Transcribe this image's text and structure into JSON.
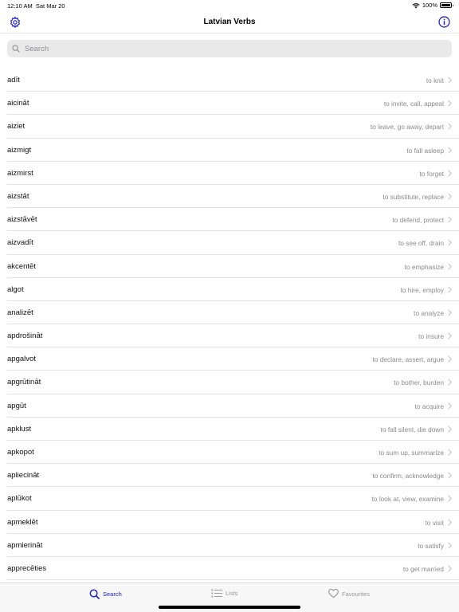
{
  "status_bar": {
    "time": "12:10 AM",
    "date": "Sat Mar 20",
    "battery": "100%",
    "battery_level": 1.0
  },
  "nav": {
    "title": "Latvian Verbs"
  },
  "search": {
    "placeholder": "Search"
  },
  "verbs": [
    {
      "verb": "adīt",
      "translation": "to knit"
    },
    {
      "verb": "aicināt",
      "translation": "to invite, call, appeal"
    },
    {
      "verb": "aiziet",
      "translation": "to leave, go away, depart"
    },
    {
      "verb": "aizmigt",
      "translation": "to fall asleep"
    },
    {
      "verb": "aizmirst",
      "translation": "to forget"
    },
    {
      "verb": "aizstāt",
      "translation": "to substitute, replace"
    },
    {
      "verb": "aizstāvēt",
      "translation": "to defend, protect"
    },
    {
      "verb": "aizvadīt",
      "translation": "to see off, drain"
    },
    {
      "verb": "akcentēt",
      "translation": "to emphasize"
    },
    {
      "verb": "algot",
      "translation": "to hire, employ"
    },
    {
      "verb": "analizēt",
      "translation": "to analyze"
    },
    {
      "verb": "apdrošināt",
      "translation": "to insure"
    },
    {
      "verb": "apgalvot",
      "translation": "to declare, assert, argue"
    },
    {
      "verb": "apgrūtināt",
      "translation": "to bother, burden"
    },
    {
      "verb": "apgūt",
      "translation": "to acquire"
    },
    {
      "verb": "apklust",
      "translation": "to fall silent, die down"
    },
    {
      "verb": "apkopot",
      "translation": "to sum up, summarize"
    },
    {
      "verb": "apliecināt",
      "translation": "to confirm, acknowledge"
    },
    {
      "verb": "aplūkot",
      "translation": "to look at, view, examine"
    },
    {
      "verb": "apmeklēt",
      "translation": "to visit"
    },
    {
      "verb": "apmierināt",
      "translation": "to satisfy"
    },
    {
      "verb": "apprecēties",
      "translation": "to get married"
    }
  ],
  "tabs": [
    {
      "label": "Search",
      "icon": "magnifier-icon",
      "active": true
    },
    {
      "label": "Lists",
      "icon": "list-icon",
      "active": false
    },
    {
      "label": "Favourites",
      "icon": "heart-icon",
      "active": false
    }
  ],
  "colors": {
    "accent": "#1d21c9",
    "secondary_text": "#8a8a8e",
    "separator": "#e3e3e5"
  }
}
